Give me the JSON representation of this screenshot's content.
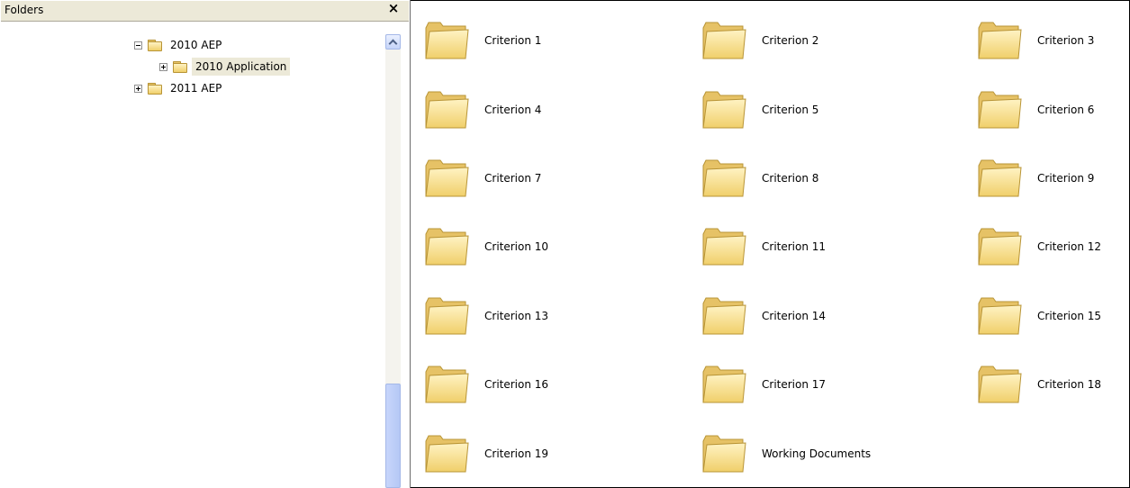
{
  "folders_pane": {
    "title": "Folders",
    "close_glyph": "×",
    "tree": [
      {
        "label": "2010 AEP",
        "expander": "minus",
        "level": 0,
        "selected": false
      },
      {
        "label": "2010 Application",
        "expander": "plus",
        "level": 1,
        "selected": true
      },
      {
        "label": "2011 AEP",
        "expander": "plus",
        "level": 0,
        "selected": false
      }
    ]
  },
  "content": {
    "items": [
      {
        "label": "Criterion 1",
        "icon": "folder-icon"
      },
      {
        "label": "Criterion 2",
        "icon": "folder-icon"
      },
      {
        "label": "Criterion 3",
        "icon": "folder-icon"
      },
      {
        "label": "Criterion 4",
        "icon": "folder-icon"
      },
      {
        "label": "Criterion 5",
        "icon": "folder-icon"
      },
      {
        "label": "Criterion 6",
        "icon": "folder-icon"
      },
      {
        "label": "Criterion 7",
        "icon": "folder-icon"
      },
      {
        "label": "Criterion 8",
        "icon": "folder-icon"
      },
      {
        "label": "Criterion 9",
        "icon": "folder-icon"
      },
      {
        "label": "Criterion 10",
        "icon": "folder-icon"
      },
      {
        "label": "Criterion 11",
        "icon": "folder-icon"
      },
      {
        "label": "Criterion 12",
        "icon": "folder-icon"
      },
      {
        "label": "Criterion 13",
        "icon": "folder-icon"
      },
      {
        "label": "Criterion 14",
        "icon": "folder-icon"
      },
      {
        "label": "Criterion 15",
        "icon": "folder-icon"
      },
      {
        "label": "Criterion 16",
        "icon": "folder-icon"
      },
      {
        "label": "Criterion 17",
        "icon": "folder-icon"
      },
      {
        "label": "Criterion 18",
        "icon": "folder-icon"
      },
      {
        "label": "Criterion 19",
        "icon": "folder-icon"
      },
      {
        "label": "Working Documents",
        "icon": "folder-icon"
      }
    ]
  },
  "colors": {
    "folder_fill_light": "#fff3c4",
    "folder_fill_dark": "#f0cf6a",
    "folder_outline": "#b89436",
    "pane_header": "#ece9d8",
    "selected_tree_item": "#ece9d8"
  }
}
